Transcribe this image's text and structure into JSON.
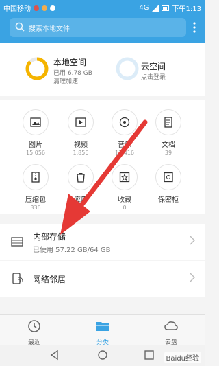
{
  "status_bar": {
    "carrier": "中国移动",
    "time": "下午1:13",
    "network": "4G"
  },
  "search": {
    "placeholder": "搜索本地文件"
  },
  "storage": {
    "local": {
      "title": "本地空间",
      "subtitle": "已用 6.78 GB",
      "action": "清理加速"
    },
    "cloud": {
      "title": "云空间",
      "action": "点击登录"
    }
  },
  "categories": [
    {
      "label": "图片",
      "count": "15,056",
      "icon": "image-icon"
    },
    {
      "label": "视频",
      "count": "1,856",
      "icon": "video-icon"
    },
    {
      "label": "音乐",
      "count": "13,416",
      "icon": "music-icon"
    },
    {
      "label": "文档",
      "count": "39",
      "icon": "document-icon"
    },
    {
      "label": "压缩包",
      "count": "336",
      "icon": "zip-icon"
    },
    {
      "label": "应用",
      "count": "",
      "icon": "app-icon"
    },
    {
      "label": "收藏",
      "count": "0",
      "icon": "star-icon"
    },
    {
      "label": "保密柜",
      "count": "",
      "icon": "safe-icon"
    }
  ],
  "locations": {
    "internal": {
      "title": "内部存储",
      "subtitle": "已使用 57.22 GB/64 GB"
    },
    "network": {
      "title": "网络邻居"
    }
  },
  "tabs": [
    {
      "label": "最近",
      "icon": "clock-icon"
    },
    {
      "label": "分类",
      "icon": "folder-icon"
    },
    {
      "label": "云盘",
      "icon": "cloud-icon"
    }
  ],
  "watermark": "Baidu经验",
  "colors": {
    "accent": "#3aa3e3",
    "arrow": "#e53935",
    "local_ring": "#f5b400",
    "cloud_ring": "#dcecf8"
  }
}
